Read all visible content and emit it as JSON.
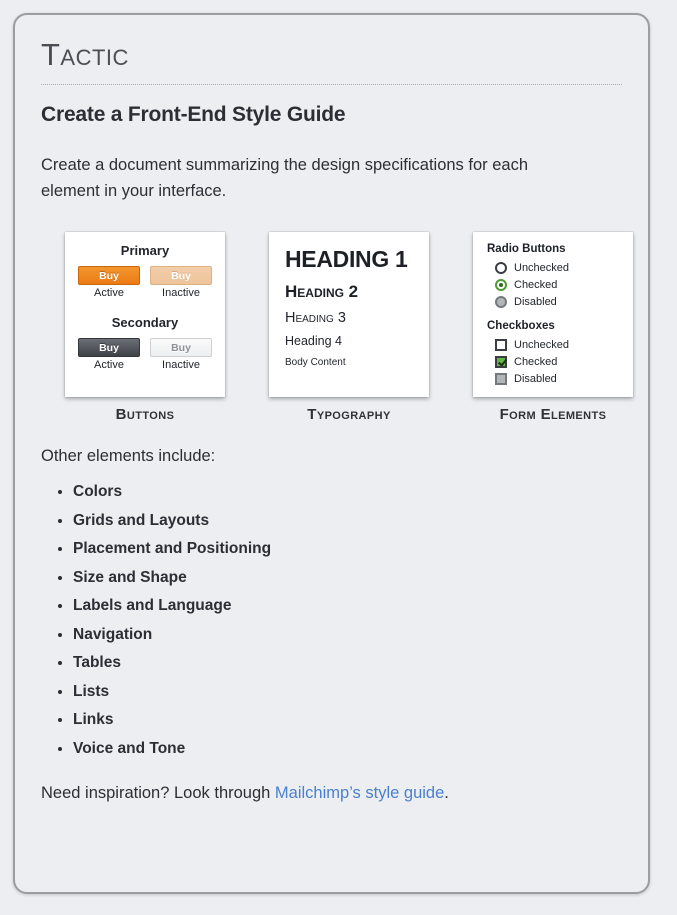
{
  "header": {
    "eyebrow": "Tactic",
    "title": "Create a Front-End Style Guide",
    "intro": "Create a document summarizing the design specifications for each element in your interface."
  },
  "cards": {
    "buttons": {
      "caption": "Buttons",
      "groups": [
        {
          "label": "Primary",
          "buttons": [
            {
              "text": "Buy",
              "state": "Active"
            },
            {
              "text": "Buy",
              "state": "Inactive"
            }
          ]
        },
        {
          "label": "Secondary",
          "buttons": [
            {
              "text": "Buy",
              "state": "Active"
            },
            {
              "text": "Buy",
              "state": "Inactive"
            }
          ]
        }
      ]
    },
    "typography": {
      "caption": "Typography",
      "samples": {
        "h1": "HEADING 1",
        "h2": "Heading 2",
        "h3": "Heading 3",
        "h4": "Heading 4",
        "body": "Body Content"
      }
    },
    "form_elements": {
      "caption": "Form Elements",
      "radio_group_label": "Radio Buttons",
      "radio_states": [
        "Unchecked",
        "Checked",
        "Disabled"
      ],
      "checkbox_group_label": "Checkboxes",
      "checkbox_states": [
        "Unchecked",
        "Checked",
        "Disabled"
      ]
    }
  },
  "other": {
    "lead": "Other elements include:",
    "items": [
      "Colors",
      "Grids and Layouts",
      "Placement and Positioning",
      "Size and Shape",
      "Labels and Language",
      "Navigation",
      "Tables",
      "Lists",
      "Links",
      "Voice and Tone"
    ]
  },
  "footer": {
    "prefix": "Need inspiration? Look through ",
    "link_text": "Mailchimp’s style guide",
    "suffix": "."
  },
  "colors": {
    "page_bg": "#eceef1",
    "border": "#9b9da1",
    "text": "#2b2f35",
    "link": "#4a80cf",
    "primary_button": "#ec7b15",
    "primary_button_inactive": "#eec49a",
    "secondary_button": "#3e4247",
    "checked_green": "#65b544"
  }
}
